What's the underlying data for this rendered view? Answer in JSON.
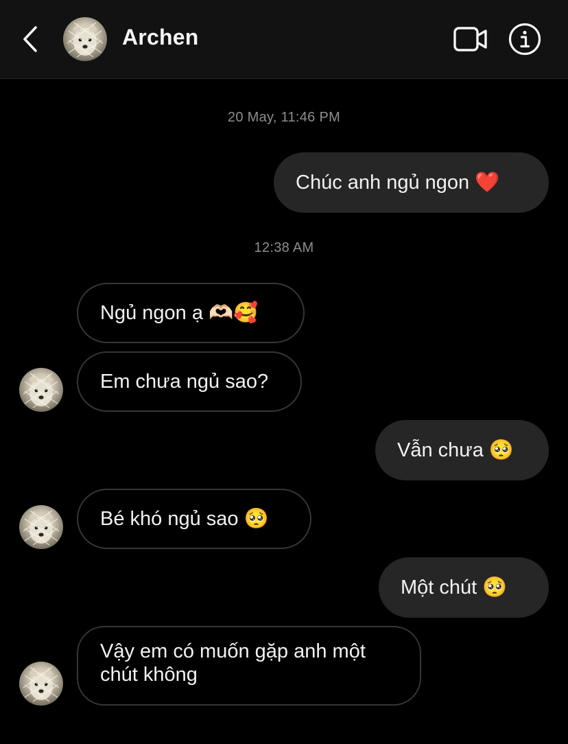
{
  "header": {
    "contact_name": "Archen",
    "back_icon": "chevron-left-icon",
    "video_icon": "video-camera-icon",
    "info_icon": "info-icon"
  },
  "colors": {
    "background": "#000000",
    "header_bg": "#121212",
    "outgoing_bubble": "#262626",
    "incoming_border": "#363636",
    "timestamp_text": "#8e8e8e"
  },
  "conversation": {
    "timestamps": [
      "20 May, 11:46 PM",
      "12:38 AM"
    ],
    "messages": [
      {
        "direction": "outgoing",
        "text": "Chúc anh ngủ ngon ❤️"
      },
      {
        "direction": "incoming",
        "text": "Ngủ ngon ạ 🫶🏻🥰"
      },
      {
        "direction": "incoming",
        "text": "Em chưa ngủ sao?"
      },
      {
        "direction": "outgoing",
        "text": "Vẫn chưa 🥺"
      },
      {
        "direction": "incoming",
        "text": "Bé khó ngủ sao 🥺"
      },
      {
        "direction": "outgoing",
        "text": "Một chút 🥺"
      },
      {
        "direction": "incoming",
        "text": "Vậy em có muốn gặp anh một chút không"
      }
    ]
  }
}
